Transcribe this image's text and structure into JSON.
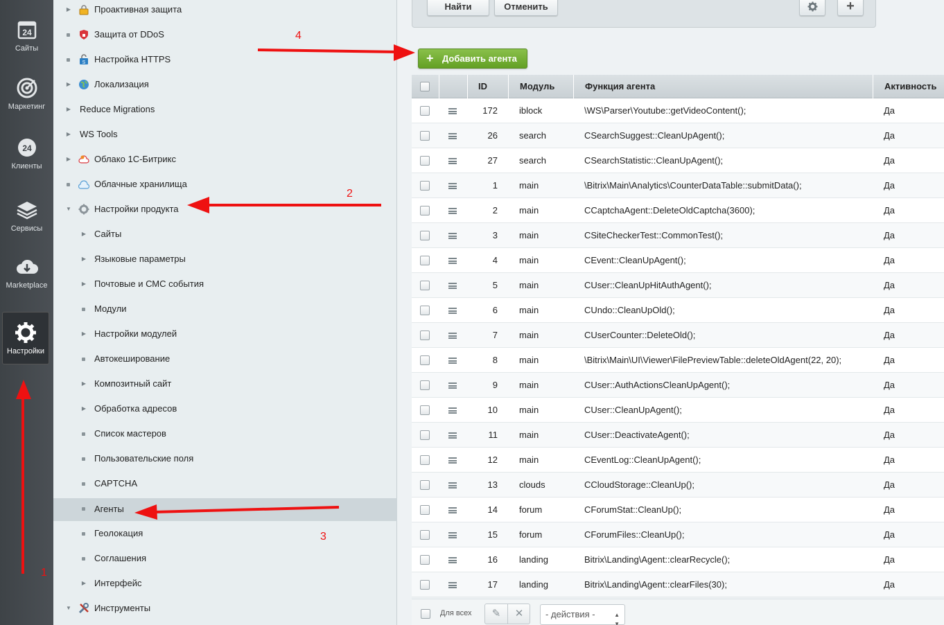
{
  "leftbar": {
    "items": [
      {
        "label": "Сайты",
        "icon": "calendar-24-icon"
      },
      {
        "label": "Маркетинг",
        "icon": "target-icon"
      },
      {
        "label": "Клиенты",
        "icon": "clients-24-icon"
      },
      {
        "label": "Сервисы",
        "icon": "layers-icon"
      },
      {
        "label": "Marketplace",
        "icon": "cloud-download-icon"
      },
      {
        "label": "Настройки",
        "icon": "gear-icon"
      }
    ]
  },
  "tree": {
    "items": [
      {
        "label": "Проактивная защита",
        "icon": "lock-icon"
      },
      {
        "label": "Защита от DDoS",
        "icon": "shield-icon"
      },
      {
        "label": "Настройка HTTPS",
        "icon": "https-lock-icon"
      },
      {
        "label": "Локализация",
        "icon": "globe-icon"
      },
      {
        "label": "Reduce Migrations"
      },
      {
        "label": "WS Tools"
      },
      {
        "label": "Облако 1С-Битрикс",
        "icon": "cloud-icon"
      },
      {
        "label": "Облачные хранилища",
        "icon": "flask-icon"
      },
      {
        "label": "Настройки продукта",
        "icon": "settings-icon"
      },
      {
        "label": "Сайты"
      },
      {
        "label": "Языковые параметры"
      },
      {
        "label": "Почтовые и СМС события"
      },
      {
        "label": "Модули"
      },
      {
        "label": "Настройки модулей"
      },
      {
        "label": "Автокеширование"
      },
      {
        "label": "Композитный сайт"
      },
      {
        "label": "Обработка адресов"
      },
      {
        "label": "Список мастеров"
      },
      {
        "label": "Пользовательские поля"
      },
      {
        "label": "CAPTCHA"
      },
      {
        "label": "Агенты"
      },
      {
        "label": "Геолокация"
      },
      {
        "label": "Соглашения"
      },
      {
        "label": "Интерфейс"
      },
      {
        "label": "Инструменты",
        "icon": "tools-icon"
      }
    ]
  },
  "filter": {
    "find_label": "Найти",
    "cancel_label": "Отменить"
  },
  "toolbar": {
    "add_label": "Добавить агента"
  },
  "grid": {
    "headers": {
      "id": "ID",
      "module": "Модуль",
      "func": "Функция агента",
      "active": "Активность"
    },
    "rows": [
      {
        "id": "172",
        "module": "iblock",
        "func": "\\WS\\Parser\\Youtube::getVideoContent();",
        "active": "Да"
      },
      {
        "id": "26",
        "module": "search",
        "func": "CSearchSuggest::CleanUpAgent();",
        "active": "Да"
      },
      {
        "id": "27",
        "module": "search",
        "func": "CSearchStatistic::CleanUpAgent();",
        "active": "Да"
      },
      {
        "id": "1",
        "module": "main",
        "func": "\\Bitrix\\Main\\Analytics\\CounterDataTable::submitData();",
        "active": "Да"
      },
      {
        "id": "2",
        "module": "main",
        "func": "CCaptchaAgent::DeleteOldCaptcha(3600);",
        "active": "Да"
      },
      {
        "id": "3",
        "module": "main",
        "func": "CSiteCheckerTest::CommonTest();",
        "active": "Да"
      },
      {
        "id": "4",
        "module": "main",
        "func": "CEvent::CleanUpAgent();",
        "active": "Да"
      },
      {
        "id": "5",
        "module": "main",
        "func": "CUser::CleanUpHitAuthAgent();",
        "active": "Да"
      },
      {
        "id": "6",
        "module": "main",
        "func": "CUndo::CleanUpOld();",
        "active": "Да"
      },
      {
        "id": "7",
        "module": "main",
        "func": "CUserCounter::DeleteOld();",
        "active": "Да"
      },
      {
        "id": "8",
        "module": "main",
        "func": "\\Bitrix\\Main\\UI\\Viewer\\FilePreviewTable::deleteOldAgent(22, 20);",
        "active": "Да"
      },
      {
        "id": "9",
        "module": "main",
        "func": "CUser::AuthActionsCleanUpAgent();",
        "active": "Да"
      },
      {
        "id": "10",
        "module": "main",
        "func": "CUser::CleanUpAgent();",
        "active": "Да"
      },
      {
        "id": "11",
        "module": "main",
        "func": "CUser::DeactivateAgent();",
        "active": "Да"
      },
      {
        "id": "12",
        "module": "main",
        "func": "CEventLog::CleanUpAgent();",
        "active": "Да"
      },
      {
        "id": "13",
        "module": "clouds",
        "func": "CCloudStorage::CleanUp();",
        "active": "Да"
      },
      {
        "id": "14",
        "module": "forum",
        "func": "CForumStat::CleanUp();",
        "active": "Да"
      },
      {
        "id": "15",
        "module": "forum",
        "func": "CForumFiles::CleanUp();",
        "active": "Да"
      },
      {
        "id": "16",
        "module": "landing",
        "func": "Bitrix\\Landing\\Agent::clearRecycle();",
        "active": "Да"
      },
      {
        "id": "17",
        "module": "landing",
        "func": "Bitrix\\Landing\\Agent::clearFiles(30);",
        "active": "Да"
      }
    ]
  },
  "footer": {
    "for_all_label": "Для всех",
    "actions_placeholder": "- действия -"
  },
  "annotations": {
    "n1": "1",
    "n2": "2",
    "n3": "3",
    "n4": "4"
  },
  "colors": {
    "accent_green": "#63a024",
    "annotation_red": "#ee1111",
    "sidebar_dark": "#3e4347"
  }
}
